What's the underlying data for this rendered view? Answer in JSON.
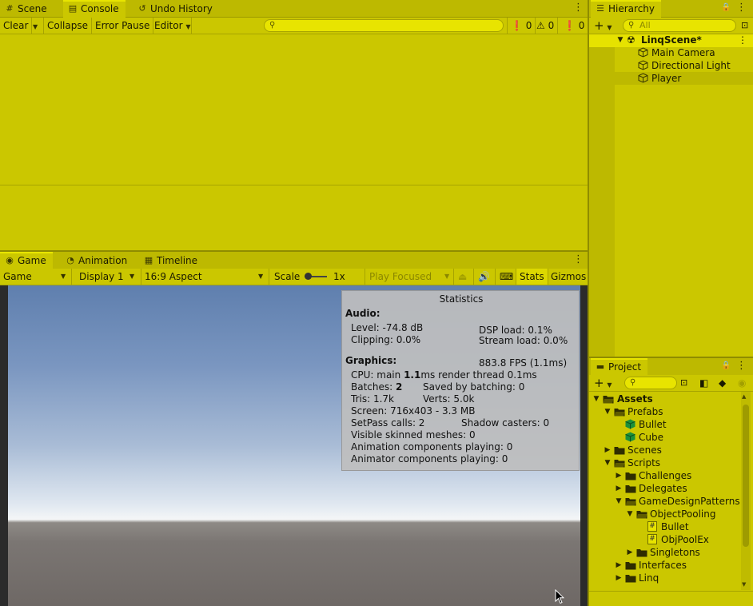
{
  "top_tabs": [
    {
      "label": "Scene",
      "icon": "scene-icon"
    },
    {
      "label": "Console",
      "icon": "console-icon"
    },
    {
      "label": "Undo History",
      "icon": "undo-history-icon"
    }
  ],
  "console_toolbar": {
    "clear": "Clear",
    "collapse": "Collapse",
    "error_pause": "Error Pause",
    "editor": "Editor",
    "error_count": "0",
    "warning_count": "0",
    "info_count": "0"
  },
  "game_tabs": [
    {
      "label": "Game",
      "icon": "gamepad-icon"
    },
    {
      "label": "Animation",
      "icon": "animation-icon"
    },
    {
      "label": "Timeline",
      "icon": "timeline-icon"
    }
  ],
  "game_toolbar": {
    "view": "Game",
    "display": "Display 1",
    "aspect": "16:9 Aspect",
    "scale_label": "Scale",
    "scale_value": "1x",
    "play_mode": "Play Focused",
    "stats": "Stats",
    "gizmos": "Gizmos"
  },
  "statistics": {
    "title": "Statistics",
    "audio_header": "Audio:",
    "level": "Level: -74.8 dB",
    "clipping": "Clipping: 0.0%",
    "dsp_load": "DSP load: 0.1%",
    "stream_load": "Stream load: 0.0%",
    "graphics_header": "Graphics:",
    "fps": "883.8 FPS (1.1ms)",
    "cpu_prefix": "CPU: main ",
    "cpu_main": "1.1",
    "cpu_suffix": "ms  render thread 0.1ms",
    "batches_prefix": "Batches: ",
    "batches_value": "2",
    "saved_by_batching": "Saved by batching: 0",
    "tris": "Tris: 1.7k",
    "verts": "Verts: 5.0k",
    "screen": "Screen: 716x403 - 3.3 MB",
    "setpass": "SetPass calls: 2",
    "shadow_casters": "Shadow casters: 0",
    "skinned": "Visible skinned meshes: 0",
    "anim_components": "Animation components playing: 0",
    "animator_components": "Animator components playing: 0"
  },
  "hierarchy": {
    "tab": "Hierarchy",
    "search_placeholder": "All",
    "scene": "LinqScene*",
    "items": [
      "Main Camera",
      "Directional Light",
      "Player"
    ]
  },
  "project": {
    "tab": "Project",
    "tree": [
      {
        "label": "Assets",
        "depth": 0,
        "type": "folder",
        "expanded": true,
        "bold": true
      },
      {
        "label": "Prefabs",
        "depth": 1,
        "type": "folder",
        "expanded": true
      },
      {
        "label": "Bullet",
        "depth": 2,
        "type": "prefab"
      },
      {
        "label": "Cube",
        "depth": 2,
        "type": "prefab"
      },
      {
        "label": "Scenes",
        "depth": 1,
        "type": "folder",
        "expanded": false
      },
      {
        "label": "Scripts",
        "depth": 1,
        "type": "folder",
        "expanded": true
      },
      {
        "label": "Challenges",
        "depth": 2,
        "type": "folder",
        "expanded": false
      },
      {
        "label": "Delegates",
        "depth": 2,
        "type": "folder",
        "expanded": false
      },
      {
        "label": "GameDesignPatterns",
        "depth": 2,
        "type": "folder",
        "expanded": true
      },
      {
        "label": "ObjectPooling",
        "depth": 3,
        "type": "folder",
        "expanded": true
      },
      {
        "label": "Bullet",
        "depth": 4,
        "type": "script"
      },
      {
        "label": "ObjPoolEx",
        "depth": 4,
        "type": "script"
      },
      {
        "label": "Singletons",
        "depth": 3,
        "type": "folder",
        "expanded": false
      },
      {
        "label": "Interfaces",
        "depth": 2,
        "type": "folder",
        "expanded": false
      },
      {
        "label": "Linq",
        "depth": 2,
        "type": "folder",
        "expanded": false
      }
    ]
  },
  "colors": {
    "background": "#cbc700",
    "tab_bar": "#bdb900",
    "divider": "#8f8c00"
  }
}
